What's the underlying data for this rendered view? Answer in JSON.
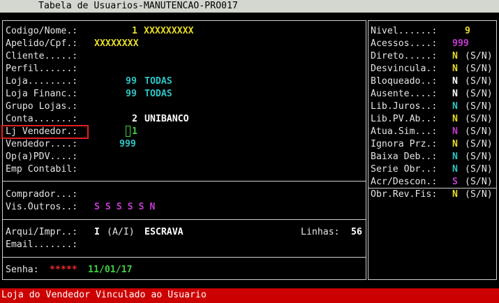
{
  "window": {
    "title": "Tabela de Usuarios-MANUTENCAO-PRO017"
  },
  "main": {
    "codigo_label": "Codigo/Nome.:",
    "codigo_value": "1",
    "nome_value": "XXXXXXXXX",
    "apelido_label": "Apelido/Cpf.:",
    "apelido_value": "XXXXXXXX",
    "cliente_label": "Cliente.....:",
    "perfil_label": "Perfil......:",
    "loja_label": "Loja........:",
    "loja_value": "99",
    "loja_desc": "TODAS",
    "lojafin_label": "Loja Financ.:",
    "lojafin_value": "99",
    "lojafin_desc": "TODAS",
    "grupo_label": "Grupo Lojas.:",
    "conta_label": "Conta.......:",
    "conta_value": "2",
    "conta_desc": "UNIBANCO",
    "ljvend_label": "Lj Vendedor.:",
    "ljvend_value": "1",
    "vendedor_label": "Vendedor....:",
    "vendedor_value": "999",
    "oppdv_label": "Op(a)PDV....:",
    "emp_label": "Emp Contabil:",
    "comprador_label": "Comprador...:",
    "visoutros_label": "Vis.Outros..:",
    "visoutros_value": "S S S S S N",
    "arqui_label": "Arqui/Impr..:",
    "arqui_value": "I",
    "arqui_hint": "(A/I)",
    "arqui_desc": "ESCRAVA",
    "linhas_label": "Linhas:",
    "linhas_value": "56",
    "email_label": "Email.......:",
    "senha_label": "Senha:",
    "senha_value": "*****",
    "senha_date": "11/01/17"
  },
  "side": {
    "nivel_label": "Nivel......:",
    "nivel_value": "9",
    "acessos_label": "Acessos....:",
    "acessos_value": "999",
    "items": [
      {
        "label": "Direto.....:",
        "value": "N",
        "hint": "(S/N)"
      },
      {
        "label": "Desvincula.:",
        "value": "N",
        "hint": "(S/N)"
      },
      {
        "label": "Bloqueado..:",
        "value": "N",
        "hint": "(S/N)"
      },
      {
        "label": "Ausente....:",
        "value": "N",
        "hint": "(S/N)"
      },
      {
        "label": "Lib.Juros..:",
        "value": "N",
        "hint": "(S/N)"
      },
      {
        "label": "Lib.PV.Ab..:",
        "value": "N",
        "hint": "(S/N)"
      },
      {
        "label": "Atua.Sim...:",
        "value": "N",
        "hint": "(S/N)"
      },
      {
        "label": "Ignora Prz.:",
        "value": "N",
        "hint": "(S/N)"
      },
      {
        "label": "Baixa Deb..:",
        "value": "N",
        "hint": "(S/N)"
      },
      {
        "label": "Serie Obr..:",
        "value": "N",
        "hint": "(S/N)"
      },
      {
        "label": "Acr/Descon.:",
        "value": "S",
        "hint": "(S/N)"
      },
      {
        "label": "Obr.Rev.Fis:",
        "value": "N",
        "hint": "(S/N)"
      }
    ]
  },
  "status": {
    "message": "Loja do Vendedor Vinculado ao Usuario"
  },
  "colors": {
    "yellow": "#e6db26",
    "cyan": "#2fc4c4",
    "magenta": "#c43bd0",
    "green": "#3fd13f",
    "status_bg": "#cc0000",
    "title_bg": "#d3d7cf"
  }
}
